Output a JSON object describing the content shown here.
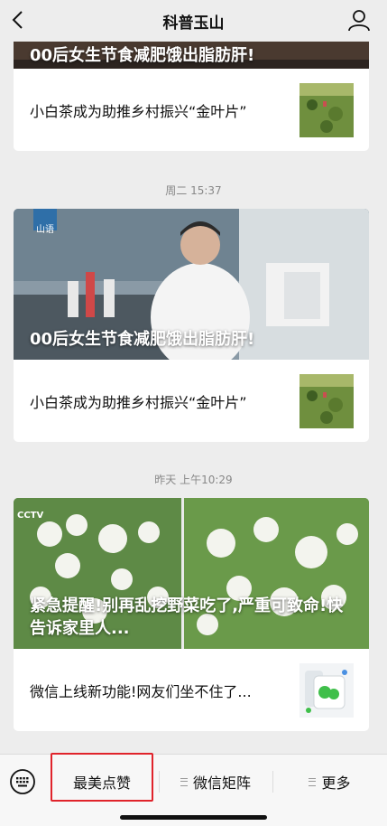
{
  "header": {
    "title": "科普玉山"
  },
  "feed": {
    "partial_top": {
      "cover_headline": "00后女生节食减肥饿出脂肪肝!",
      "item_title": "小白茶成为助推乡村振兴“金叶片”"
    },
    "groups": [
      {
        "time": "周二 15:37",
        "cover_headline": "00后女生节食减肥饿出脂肪肝!",
        "cover_logo": "山语",
        "item_title": "小白茶成为助推乡村振兴“金叶片”"
      },
      {
        "time": "昨天 上午10:29",
        "cover_headline": "紧急提醒!别再乱挖野菜吃了,严重可致命!快告诉家里人...",
        "cover_logo": "CCTV",
        "item_title": "微信上线新功能!网友们坐不住了..."
      }
    ]
  },
  "bottom_menu": {
    "items": [
      "最美点赞",
      "微信矩阵",
      "更多"
    ]
  },
  "colors": {
    "highlight": "#e0232b",
    "background": "#ededed"
  }
}
